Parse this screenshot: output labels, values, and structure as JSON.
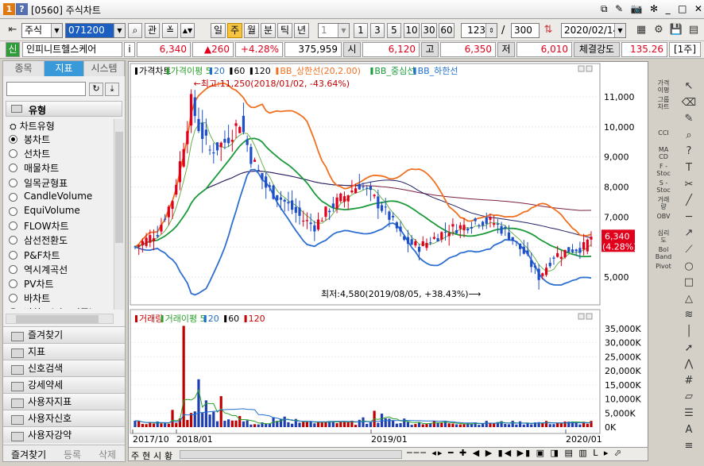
{
  "window": {
    "num": "1",
    "help": "?",
    "title": "[0560] 주식차트",
    "controls": [
      "⧉",
      "✎",
      "📷",
      "✻",
      "_",
      "□",
      "✕"
    ]
  },
  "toolbar": {
    "market": "주식",
    "code": "071200",
    "kwan": "관",
    "periods": [
      "일",
      "주",
      "월",
      "분",
      "틱",
      "년"
    ],
    "active_period": "주",
    "count_sel": "1",
    "nums": [
      "1",
      "3",
      "5",
      "10",
      "30",
      "60"
    ],
    "bars": "123",
    "slash": "/",
    "total": "300",
    "date": "2020/02/14"
  },
  "infobar": {
    "tag": "신",
    "name": "인피니트헬스케어",
    "info": "i",
    "price": "6,340",
    "change": "▲260",
    "rate": "+4.28%",
    "volume": "375,959",
    "open_lab": "시",
    "open": "6,120",
    "high_lab": "고",
    "high": "6,350",
    "low_lab": "저",
    "low": "6,010",
    "strength_lab": "체결강도",
    "strength": "135.26",
    "unit": "[1주]"
  },
  "leftpanel": {
    "tabs": [
      "종목",
      "지표",
      "시스템"
    ],
    "active_tab": "지표",
    "group": "유형",
    "subgroup": "차트유형",
    "items": [
      "봉차트",
      "선차트",
      "매물차트",
      "일목균형표",
      "CandleVolume",
      "EquiVolume",
      "FLOW차트",
      "삼선전환도",
      "P&F차트",
      "역시계곡선",
      "PV차트",
      "바차트",
      "바차트(시고저종)"
    ],
    "selected": "봉차트",
    "folders": [
      "즐겨찾기",
      "지표",
      "신호검색",
      "강세약세",
      "사용자지표",
      "사용자신호",
      "사용자강약"
    ],
    "bottom": [
      "즐겨찾기",
      "등록",
      "삭제"
    ]
  },
  "chart": {
    "price_legend": [
      {
        "text": "가격차트",
        "color": "#000000"
      },
      {
        "text": "가격이평 5",
        "color": "#2aa02a"
      },
      {
        "text": "20",
        "color": "#1f6fd0"
      },
      {
        "text": "60",
        "color": "#000000"
      },
      {
        "text": "120",
        "color": "#000000"
      },
      {
        "text": "BB_상한선(20,2.00)",
        "color": "#f07020"
      },
      {
        "text": "BB_중심선",
        "color": "#1a9a3a"
      },
      {
        "text": "BB_하한선",
        "color": "#1f6fd0"
      }
    ],
    "max_note": "←최고:11,250(2018/01/02, -43.64%)",
    "min_note": "최저:4,580(2019/08/05, +38.43%)⟶",
    "price_ticks": [
      "11,000",
      "10,000",
      "9,000",
      "8,000",
      "7,000",
      "6,000",
      "5,000"
    ],
    "cur_price": "6,340",
    "cur_rate": "(4.28%)",
    "vol_legend": [
      {
        "text": "거래량",
        "color": "#cc0000"
      },
      {
        "text": "거래이평 5",
        "color": "#2aa02a"
      },
      {
        "text": "20",
        "color": "#1f6fd0"
      },
      {
        "text": "60",
        "color": "#000000"
      },
      {
        "text": "120",
        "color": "#cc0000"
      }
    ],
    "vol_ticks": [
      "35,000K",
      "30,000K",
      "25,000K",
      "20,000K",
      "15,000K",
      "10,000K",
      "5,000K",
      "0K"
    ],
    "x_labels": [
      "2017/10",
      "2018/01",
      "2019/01",
      "2020/01"
    ]
  },
  "righttools": [
    "가격\n이평",
    "그룹\n차트",
    "",
    "CCI",
    "MA\nCD",
    "F -\nStoc",
    "S -\nStoc",
    "거래\n량",
    "OBV",
    "심리\n도",
    "Bol\nBand",
    "Pivot"
  ],
  "bottombar": {
    "tabs": [
      "주",
      "현",
      "시",
      "황"
    ]
  }
}
